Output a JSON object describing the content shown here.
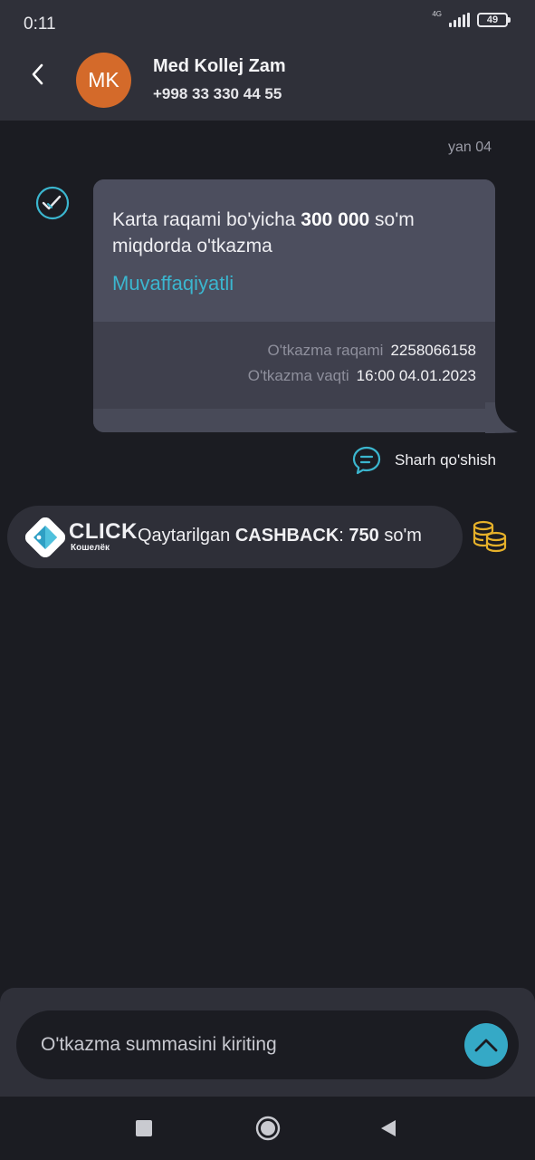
{
  "status_bar": {
    "time": "0:11",
    "network": "4G",
    "battery": "49"
  },
  "header": {
    "avatar_initials": "MK",
    "contact_name": "Med Kollej Zam",
    "contact_phone": "+998 33 330 44 55"
  },
  "message": {
    "date": "yan 04",
    "text_before": "Karta raqami bo'yicha ",
    "amount": "300 000",
    "text_after": " so'm miqdorda o'tkazma",
    "status": "Muvaffaqiyatli",
    "transfer_number_label": "O'tkazma raqami",
    "transfer_number": "2258066158",
    "transfer_time_label": "O'tkazma vaqti",
    "transfer_time": "16:00 04.01.2023",
    "comment_label": "Sharh qo'shish"
  },
  "cashback": {
    "brand": "CLICK",
    "brand_sub": "Кошелёк",
    "prefix": "Qaytarilgan ",
    "label": "CASHBACK",
    "colon": ": ",
    "value": "750",
    "currency": " so'm"
  },
  "composer": {
    "placeholder": "O'tkazma summasini kiriting"
  },
  "colors": {
    "accent": "#35a9c6",
    "status_success": "#3bb6cf",
    "avatar": "#d46a2a",
    "coins": "#e6b12a"
  }
}
